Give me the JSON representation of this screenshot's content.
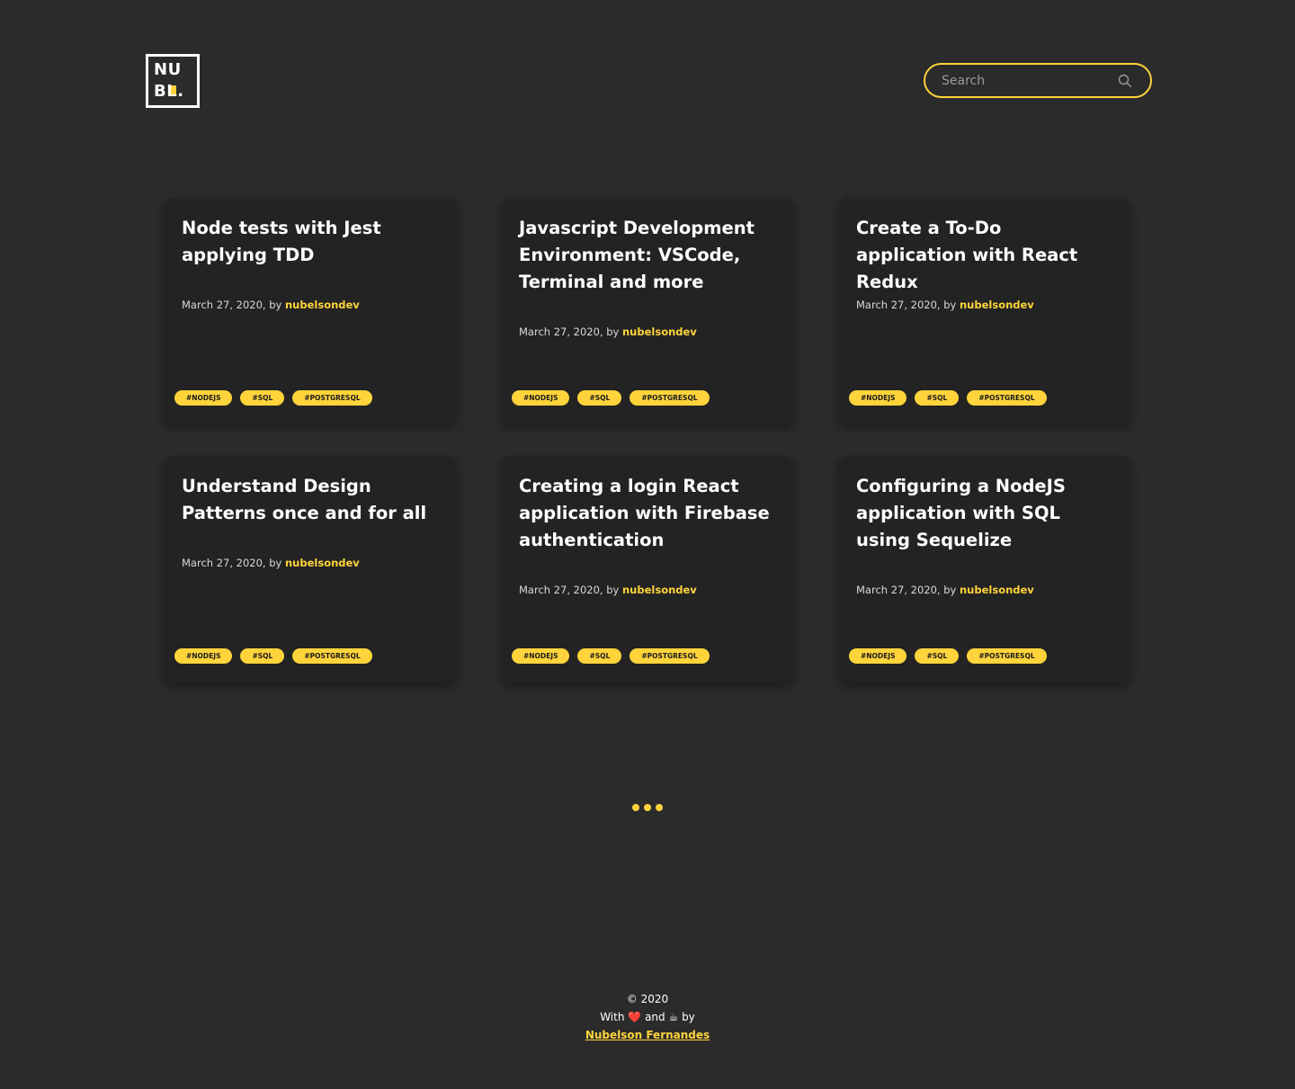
{
  "brand": {
    "logo_line1": "NU",
    "logo_line2": "BL.",
    "accent_color": "#ffd43b",
    "background_color": "#2b2b2b"
  },
  "search": {
    "placeholder": "Search",
    "icon": "search-icon"
  },
  "posts": [
    {
      "title": "Node tests with Jest applying TDD",
      "date": "March 27, 2020, by",
      "author": "nubelsondev",
      "tags": [
        "#NODEJS",
        "#SQL",
        "#POSTGRESQL"
      ]
    },
    {
      "title": "Javascript Development Environment: VSCode, Terminal and more",
      "date": "March 27, 2020, by",
      "author": "nubelsondev",
      "tags": [
        "#NODEJS",
        "#SQL",
        "#POSTGRESQL"
      ]
    },
    {
      "title": "Create a To-Do application with React Redux",
      "date": "March 27, 2020, by",
      "author": "nubelsondev",
      "tags": [
        "#NODEJS",
        "#SQL",
        "#POSTGRESQL"
      ]
    },
    {
      "title": "Understand Design Patterns once and for all",
      "date": "March 27, 2020, by",
      "author": "nubelsondev",
      "tags": [
        "#NODEJS",
        "#SQL",
        "#POSTGRESQL"
      ]
    },
    {
      "title": "Creating a login React application with Firebase authentication",
      "date": "March 27, 2020, by",
      "author": "nubelsondev",
      "tags": [
        "#NODEJS",
        "#SQL",
        "#POSTGRESQL"
      ]
    },
    {
      "title": "Configuring a NodeJS application with SQL using Sequelize",
      "date": "March 27, 2020, by",
      "author": "nubelsondev",
      "tags": [
        "#NODEJS",
        "#SQL",
        "#POSTGRESQL"
      ]
    }
  ],
  "loader": {
    "icon": "loading-dots-icon"
  },
  "footer": {
    "copyright": "© 2020",
    "with": "With",
    "heart": "❤️",
    "and": "and",
    "coffee": "☕",
    "by": "by",
    "author_link": "Nubelson Fernandes"
  }
}
